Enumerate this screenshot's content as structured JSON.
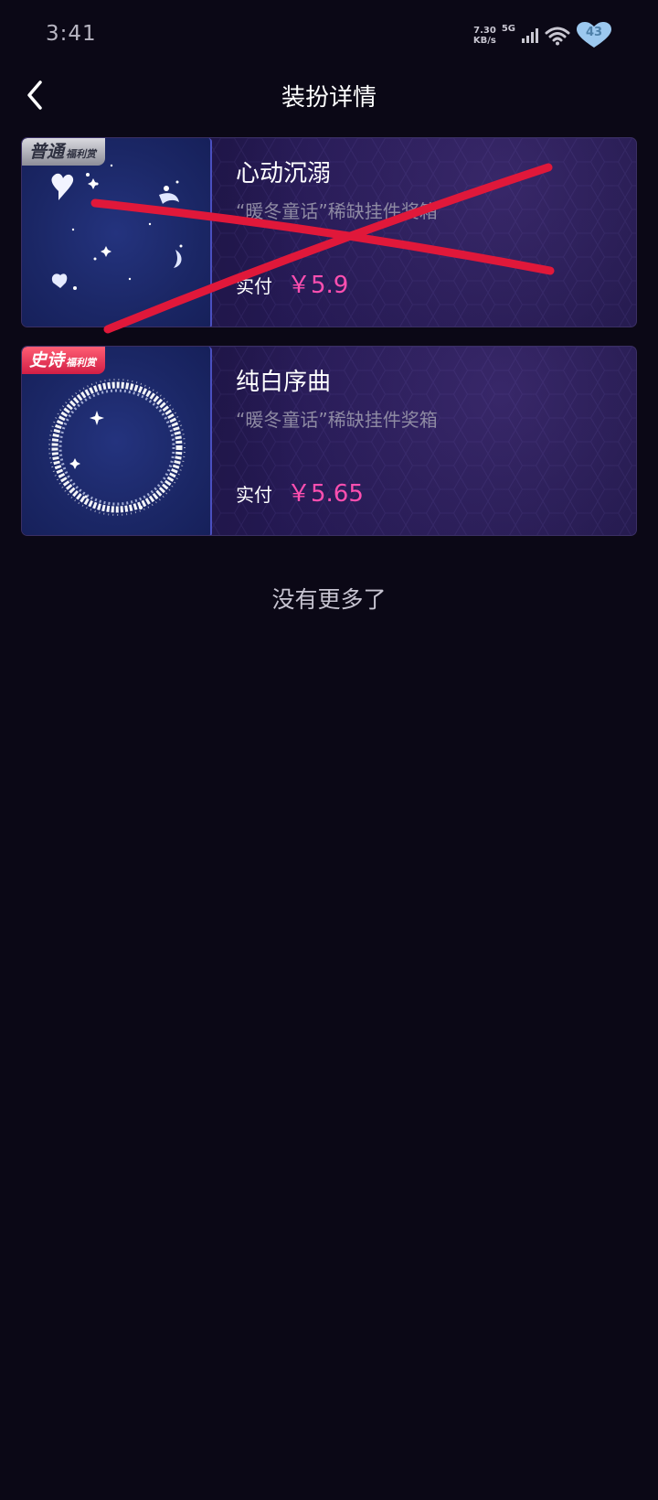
{
  "status_bar": {
    "time": "3:41",
    "net_speed_value": "7.30",
    "net_speed_unit": "KB/s",
    "network_type": "5G",
    "battery_level": "43"
  },
  "header": {
    "title": "装扮详情",
    "back_icon": "chevron-left-icon"
  },
  "items": [
    {
      "badge_main": "普通",
      "badge_sub": "福利赏",
      "name": "心动沉溺",
      "source": "“暖冬童话”稀缺挂件奖箱",
      "pay_label": "实付",
      "price": "￥5.9",
      "crossed_out": true
    },
    {
      "badge_main": "史诗",
      "badge_sub": "福利赏",
      "name": "纯白序曲",
      "source": "“暖冬童话”稀缺挂件奖箱",
      "pay_label": "实付",
      "price": "￥5.65",
      "crossed_out": false
    }
  ],
  "footer": {
    "no_more_text": "没有更多了"
  },
  "colors": {
    "background": "#0b0816",
    "price": "#ff4fb0",
    "cross_mark": "#e0183a",
    "badge_epic": "#d21e45",
    "badge_common": "#8d8e98"
  }
}
